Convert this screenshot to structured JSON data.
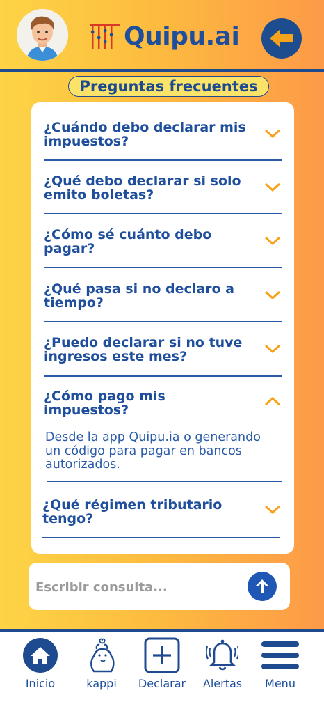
{
  "header": {
    "logo_text": "Quipu.ai",
    "avatar_icon": "user-avatar-icon",
    "back_icon": "arrow-left-icon"
  },
  "faq": {
    "title": "Preguntas frecuentes",
    "items": [
      {
        "q1": "¿Cuándo debo declarar mis",
        "q2": "impuestos?",
        "expanded": false
      },
      {
        "q1": "¿Qué debo declarar si solo",
        "q2": "emito boletas?",
        "expanded": false
      },
      {
        "q1": "¿Cómo sé cuánto debo",
        "q2": "pagar?",
        "expanded": false
      },
      {
        "q1": "¿Qué pasa si no declaro a",
        "q2": "tiempo?",
        "expanded": false
      },
      {
        "q1": "¿Puedo declarar si no tuve",
        "q2": "ingresos este mes?",
        "expanded": false
      },
      {
        "q1": "¿Cómo pago mis",
        "q2": "impuestos?",
        "expanded": true,
        "a1": "Desde la app Quipu.ia o generando",
        "a2": "un código para pagar en bancos",
        "a3": "autorizados."
      },
      {
        "q1": "¿Qué régimen tributario",
        "q2": "tengo?",
        "expanded": false
      }
    ]
  },
  "query": {
    "placeholder": "Escribir consulta...",
    "send_icon": "arrow-up-icon"
  },
  "nav": {
    "items": [
      {
        "label": "Inicio",
        "icon": "home-icon"
      },
      {
        "label": "kappi",
        "icon": "capybara-icon"
      },
      {
        "label": "Declarar",
        "icon": "plus-square-icon"
      },
      {
        "label": "Alertas",
        "icon": "bell-icon"
      },
      {
        "label": "Menu",
        "icon": "hamburger-icon"
      }
    ]
  },
  "colors": {
    "primary": "#1e4b8f",
    "accent": "#f7a21b",
    "text_blue": "#1f4f9c"
  }
}
